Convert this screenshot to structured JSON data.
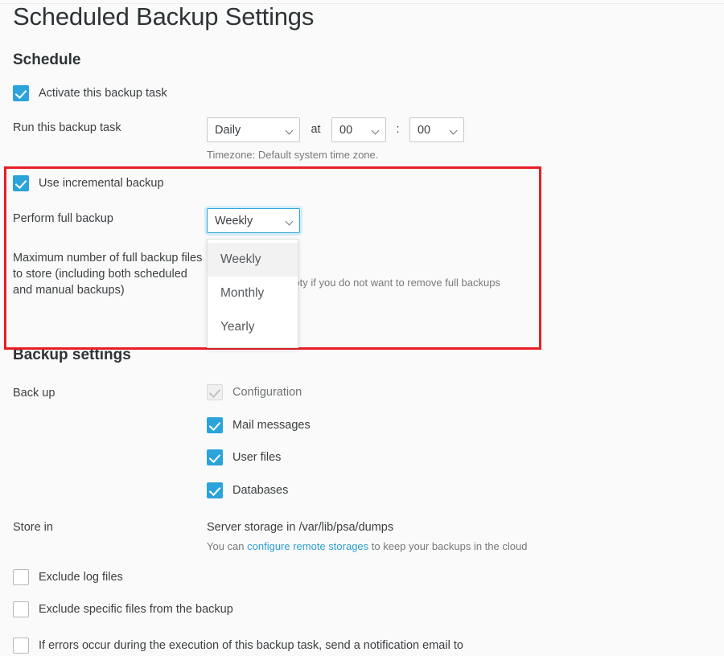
{
  "page": {
    "title": "Scheduled Backup Settings"
  },
  "schedule": {
    "heading": "Schedule",
    "activate_label": "Activate this backup task",
    "run_task_label": "Run this backup task",
    "frequency_value": "Daily",
    "at_label": "at",
    "hour_value": "00",
    "colon": ":",
    "minute_value": "00",
    "timezone_hint": "Timezone: Default system time zone."
  },
  "incremental": {
    "use_incremental_label": "Use incremental backup",
    "perform_full_label": "Perform full backup",
    "full_backup_value": "Weekly",
    "full_backup_options": [
      "Weekly",
      "Monthly",
      "Yearly"
    ],
    "max_full_label": "Maximum number of full backup files to store (including both scheduled and manual backups)",
    "max_full_hint": "Leave this field empty if you do not want to remove full backups",
    "max_full_hint_visible": "mpty if you do not want to remove full backups"
  },
  "backup_settings": {
    "heading": "Backup settings",
    "backup_label": "Back up",
    "items": [
      {
        "label": "Configuration",
        "state": "disabled-checked"
      },
      {
        "label": "Mail messages",
        "state": "checked"
      },
      {
        "label": "User files",
        "state": "checked"
      },
      {
        "label": "Databases",
        "state": "checked"
      }
    ],
    "store_in_label": "Store in",
    "store_in_value": "Server storage in /var/lib/psa/dumps",
    "store_in_hint_prefix": "You can ",
    "store_in_hint_link": "configure remote storages",
    "store_in_hint_suffix": " to keep your backups in the cloud"
  },
  "options": [
    {
      "label": "Exclude log files",
      "state": "unchecked"
    },
    {
      "label": "Exclude specific files from the backup",
      "state": "unchecked"
    },
    {
      "label": "If errors occur during the execution of this backup task, send a notification email to",
      "state": "unchecked"
    }
  ],
  "colors": {
    "accent": "#2ba3db",
    "link": "#2c9fd4",
    "annotation": "#e81e26",
    "background": "#fafafa",
    "text": "#3b3f42",
    "muted": "#78797a"
  },
  "icons": {
    "chevron_down": "chevron-down-icon",
    "checkmark": "checkmark-icon"
  }
}
